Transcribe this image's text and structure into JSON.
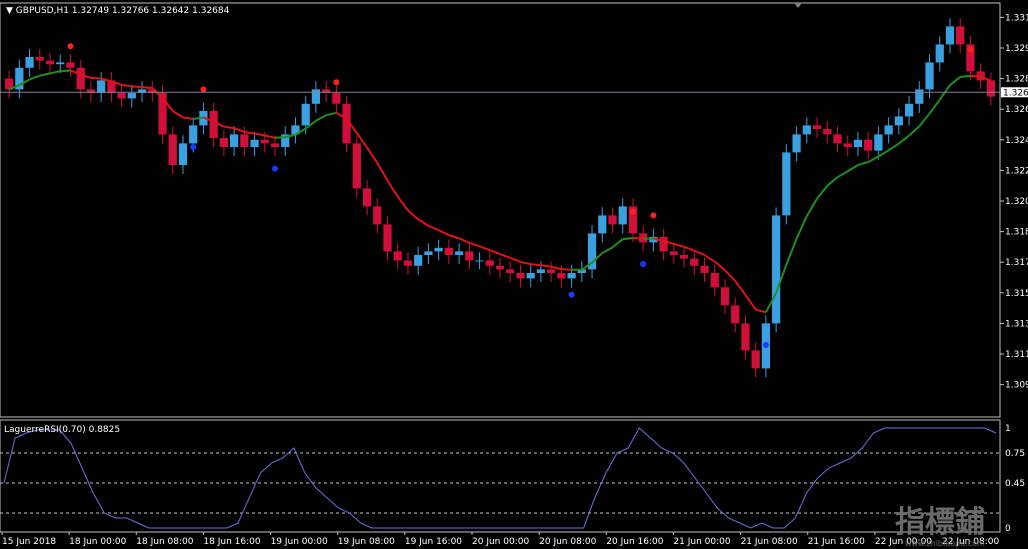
{
  "chart_data": [
    {
      "type": "candlestick",
      "symbol_timeframe": "GBPUSD,H1",
      "ohlc_readout": [
        "1.32749",
        "1.32766",
        "1.32642",
        "1.32684"
      ],
      "current_price_label": "1.326",
      "ylim": [
        1.3088,
        1.3318
      ],
      "y_tick_labels": [
        "1.331",
        "1.329",
        "1.328",
        "1.326",
        "1.324",
        "1.322",
        "1.320",
        "1.318",
        "1.317",
        "1.315",
        "1.313",
        "1.311",
        "1.309"
      ],
      "y_tick_values": [
        1.331,
        1.3293,
        1.3276,
        1.3259,
        1.3242,
        1.3225,
        1.3208,
        1.3191,
        1.3174,
        1.3157,
        1.314,
        1.3123,
        1.3106
      ],
      "x_tick_labels": [
        "15 Jun 2018",
        "18 Jun 00:00",
        "18 Jun 08:00",
        "18 Jun 16:00",
        "19 Jun 00:00",
        "19 Jun 08:00",
        "19 Jun 16:00",
        "20 Jun 00:00",
        "20 Jun 08:00",
        "20 Jun 16:00",
        "21 Jun 00:00",
        "21 Jun 08:00",
        "21 Jun 16:00",
        "22 Jun 00:00",
        "22 Jun 08:00"
      ],
      "candles_close": [
        1.327,
        1.3282,
        1.3288,
        1.3286,
        1.3284,
        1.3285,
        1.3282,
        1.327,
        1.3268,
        1.3275,
        1.3268,
        1.3265,
        1.3268,
        1.327,
        1.3268,
        1.3245,
        1.3228,
        1.324,
        1.325,
        1.3258,
        1.3243,
        1.3238,
        1.3245,
        1.3238,
        1.3242,
        1.324,
        1.3238,
        1.3245,
        1.325,
        1.3262,
        1.327,
        1.3268,
        1.3262,
        1.324,
        1.3215,
        1.3205,
        1.3195,
        1.318,
        1.3175,
        1.3172,
        1.3178,
        1.318,
        1.3182,
        1.3178,
        1.318,
        1.3175,
        1.3175,
        1.3172,
        1.317,
        1.3168,
        1.3165,
        1.3168,
        1.317,
        1.3168,
        1.3165,
        1.3168,
        1.317,
        1.319,
        1.32,
        1.3195,
        1.3205,
        1.319,
        1.3185,
        1.3188,
        1.318,
        1.3178,
        1.3176,
        1.3172,
        1.3168,
        1.316,
        1.315,
        1.314,
        1.3125,
        1.3115,
        1.314,
        1.32,
        1.3235,
        1.3245,
        1.325,
        1.3248,
        1.3245,
        1.324,
        1.3238,
        1.3242,
        1.3236,
        1.3245,
        1.325,
        1.3255,
        1.3262,
        1.327,
        1.3285,
        1.3295,
        1.3305,
        1.3295,
        1.328,
        1.3275,
        1.3266
      ],
      "indicator_lines": [
        {
          "name": "trend-ma",
          "colors": {
            "up": "#1f8f1f",
            "down": "#e01414",
            "switch": "#f0e000"
          }
        },
        {
          "name": "signal-dots",
          "colors": {
            "sell": "#ff2020",
            "buy": "#1a3cff"
          }
        }
      ]
    },
    {
      "type": "line",
      "indicator_label": "LaguerreRSI(0.70) 0.8825",
      "ylim": [
        0,
        1
      ],
      "y_tick_labels": [
        "1",
        "0.75",
        "0.45",
        "0"
      ],
      "levels": [
        0.75,
        0.45,
        0.15
      ],
      "line_color": "#6f6fe0",
      "values": [
        0.45,
        0.9,
        0.95,
        0.98,
        0.98,
        0.98,
        0.85,
        0.6,
        0.35,
        0.15,
        0.1,
        0.1,
        0.05,
        0.0,
        0.0,
        0.0,
        0.0,
        0.0,
        0.0,
        0.0,
        0.0,
        0.05,
        0.3,
        0.55,
        0.65,
        0.7,
        0.8,
        0.55,
        0.4,
        0.3,
        0.2,
        0.15,
        0.05,
        0.0,
        0.0,
        0.0,
        0.0,
        0.0,
        0.0,
        0.0,
        0.0,
        0.0,
        0.0,
        0.0,
        0.0,
        0.0,
        0.0,
        0.0,
        0.0,
        0.0,
        0.0,
        0.0,
        0.0,
        0.3,
        0.55,
        0.75,
        0.8,
        1.0,
        0.9,
        0.8,
        0.75,
        0.65,
        0.5,
        0.35,
        0.2,
        0.1,
        0.05,
        0.0,
        0.05,
        0.0,
        0.0,
        0.1,
        0.35,
        0.5,
        0.6,
        0.65,
        0.7,
        0.8,
        0.95,
        1.0,
        1.0,
        1.0,
        1.0,
        1.0,
        1.0,
        1.0,
        1.0,
        1.0,
        1.0,
        0.95
      ]
    }
  ],
  "colors": {
    "background": "#000000",
    "axis": "#c0c0c0",
    "bull_candle": "#3aa0e0",
    "bear_candle": "#d0103a",
    "price_line": "#8080a0"
  },
  "watermark": {
    "main": "指標鋪",
    "sub": "www.zhibiaopu.com"
  }
}
